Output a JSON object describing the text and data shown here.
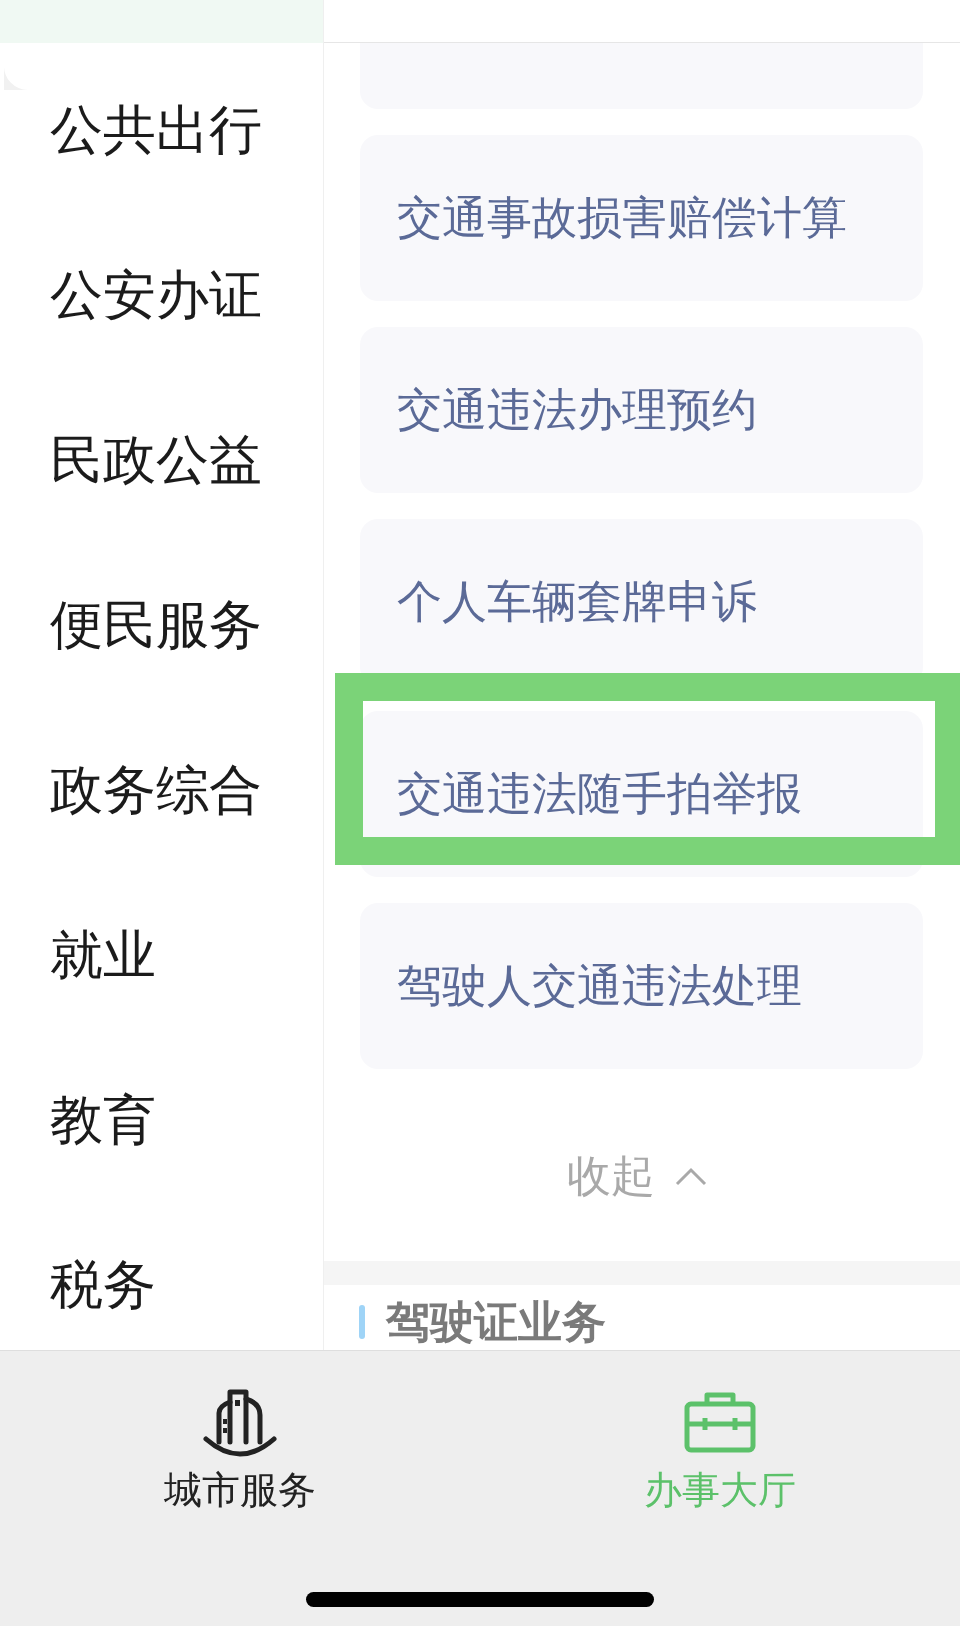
{
  "sidebar": {
    "items": [
      {
        "label": "公共出行",
        "selected": false
      },
      {
        "label": "公安办证",
        "selected": false
      },
      {
        "label": "民政公益",
        "selected": false
      },
      {
        "label": "便民服务",
        "selected": false
      },
      {
        "label": "政务综合",
        "selected": false
      },
      {
        "label": "就业",
        "selected": false
      },
      {
        "label": "教育",
        "selected": false
      },
      {
        "label": "税务",
        "selected": false
      }
    ]
  },
  "services": {
    "items": [
      {
        "label": "交通事故损害赔偿计算",
        "highlighted": false
      },
      {
        "label": "交通违法办理预约",
        "highlighted": false
      },
      {
        "label": "个人车辆套牌申诉",
        "highlighted": false
      },
      {
        "label": "交通违法随手拍举报",
        "highlighted": true
      },
      {
        "label": "驾驶人交通违法处理",
        "highlighted": false
      }
    ],
    "collapse": {
      "label": "收起"
    }
  },
  "section": {
    "title": "驾驶证业务"
  },
  "tab_bar": {
    "tabs": [
      {
        "label": "城市服务",
        "selected": false
      },
      {
        "label": "办事大厅",
        "selected": true
      }
    ]
  }
}
